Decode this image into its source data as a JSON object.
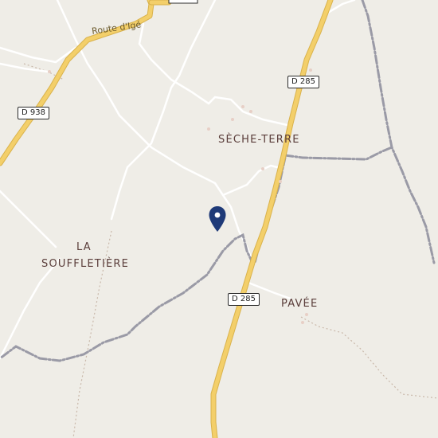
{
  "map": {
    "roads": {
      "main_route": "D 285",
      "main_route_lower": "D 285",
      "west_route": "D 938",
      "north_road": "Route d'Igé"
    },
    "places": {
      "seche_terre": "SÈCHE-TERRE",
      "la_soufflétiere_line1": "LA",
      "la_soufflétiere_line2": "SOUFFLETIÈRE",
      "pavee": "PAVÉE"
    },
    "marker": {
      "icon": "map-pin-icon",
      "color": "#1f3a78"
    },
    "colors": {
      "background": "#efede7",
      "major_road": "#f3cf6a",
      "major_road_casing": "#d9b24c",
      "minor_road": "#ffffff",
      "boundary": "#9a9aa6",
      "track": "#c9b8aa"
    }
  }
}
